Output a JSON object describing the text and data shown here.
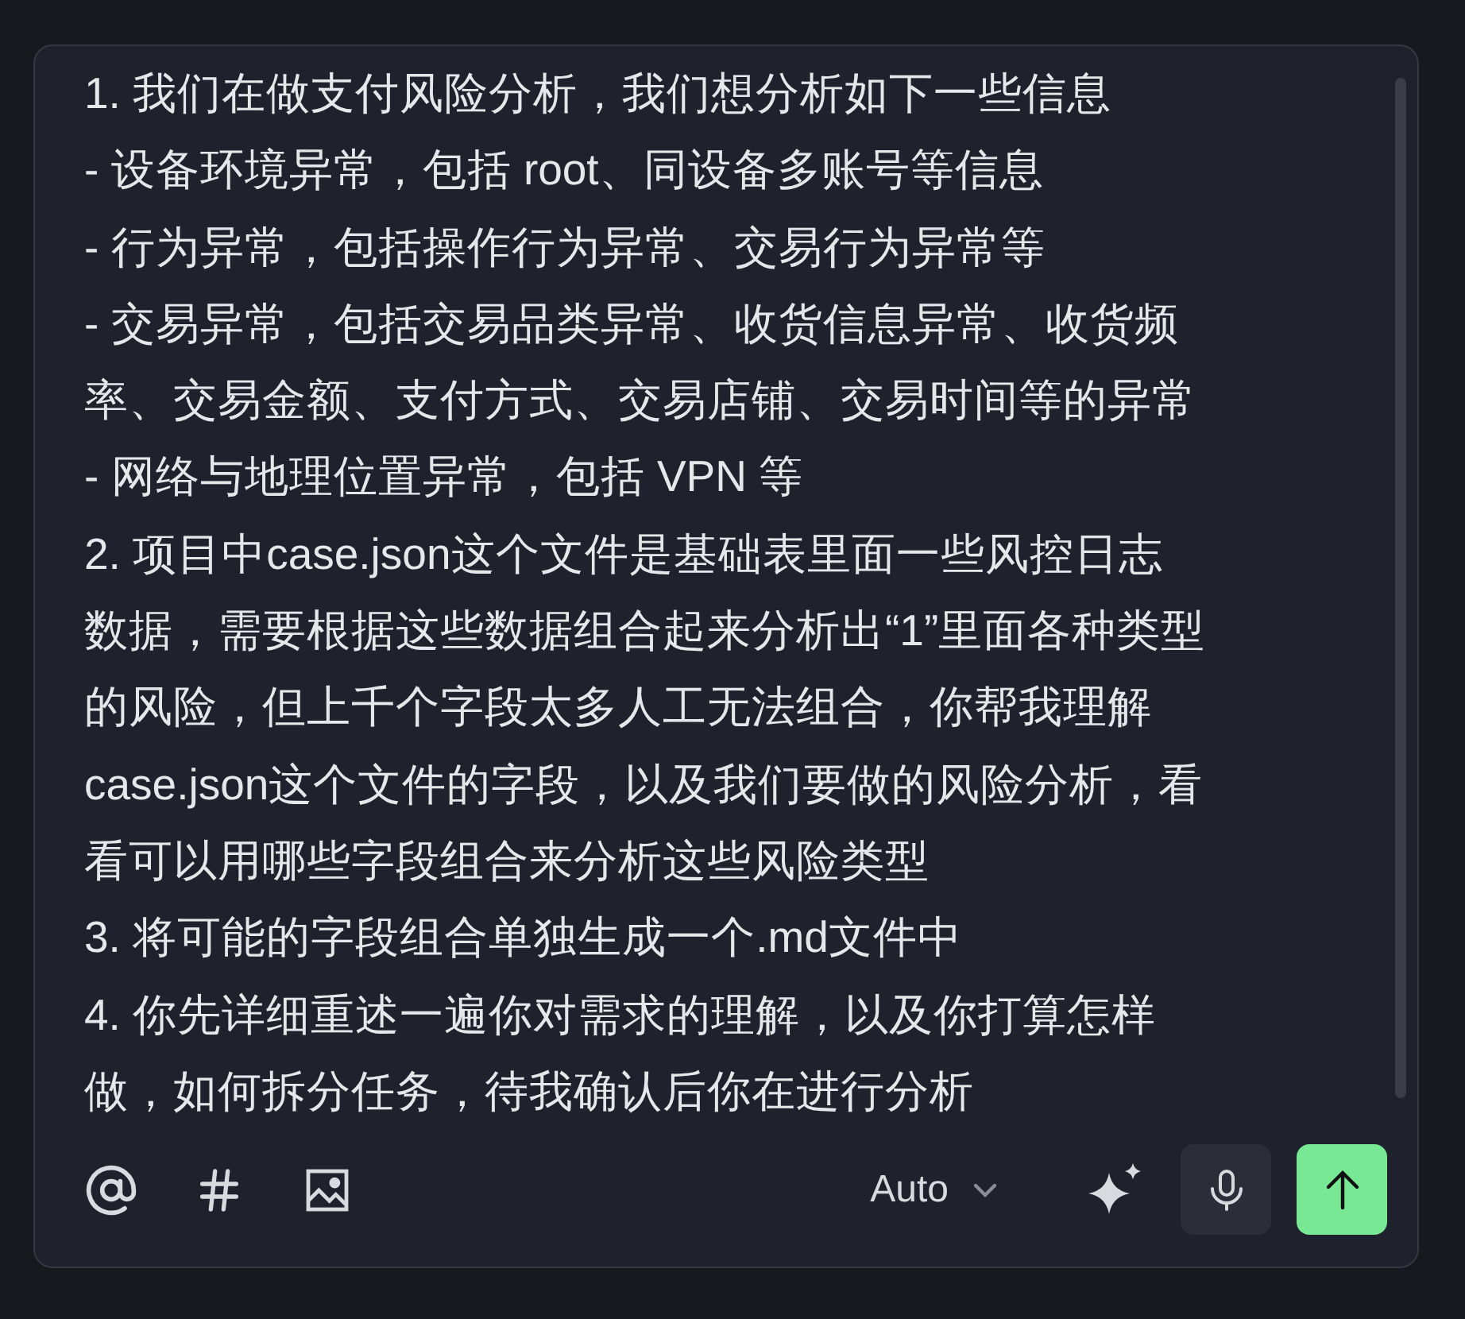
{
  "message_lines": [
    "1. 我们在做支付风险分析，我们想分析如下一些信息",
    "- 设备环境异常，包括 root、同设备多账号等信息",
    "- 行为异常，包括操作行为异常、交易行为异常等",
    "- 交易异常，包括交易品类异常、收货信息异常、收货频",
    "率、交易金额、支付方式、交易店铺、交易时间等的异常",
    "- 网络与地理位置异常，包括 VPN 等",
    "2. 项目中case.json这个文件是基础表里面一些风控日志",
    "数据，需要根据这些数据组合起来分析出“1”里面各种类型",
    "的风险，但上千个字段太多人工无法组合，你帮我理解",
    "case.json这个文件的字段，以及我们要做的风险分析，看",
    "看可以用哪些字段组合来分析这些风险类型",
    "3. 将可能的字段组合单独生成一个.md文件中",
    "4. 你先详细重述一遍你对需求的理解，以及你打算怎样",
    "做，如何拆分任务，待我确认后你在进行分析"
  ],
  "toolbar": {
    "left_tools": [
      {
        "kind": "mention"
      },
      {
        "kind": "hash"
      },
      {
        "kind": "image"
      }
    ],
    "model": "Auto",
    "send_enabled": true
  }
}
